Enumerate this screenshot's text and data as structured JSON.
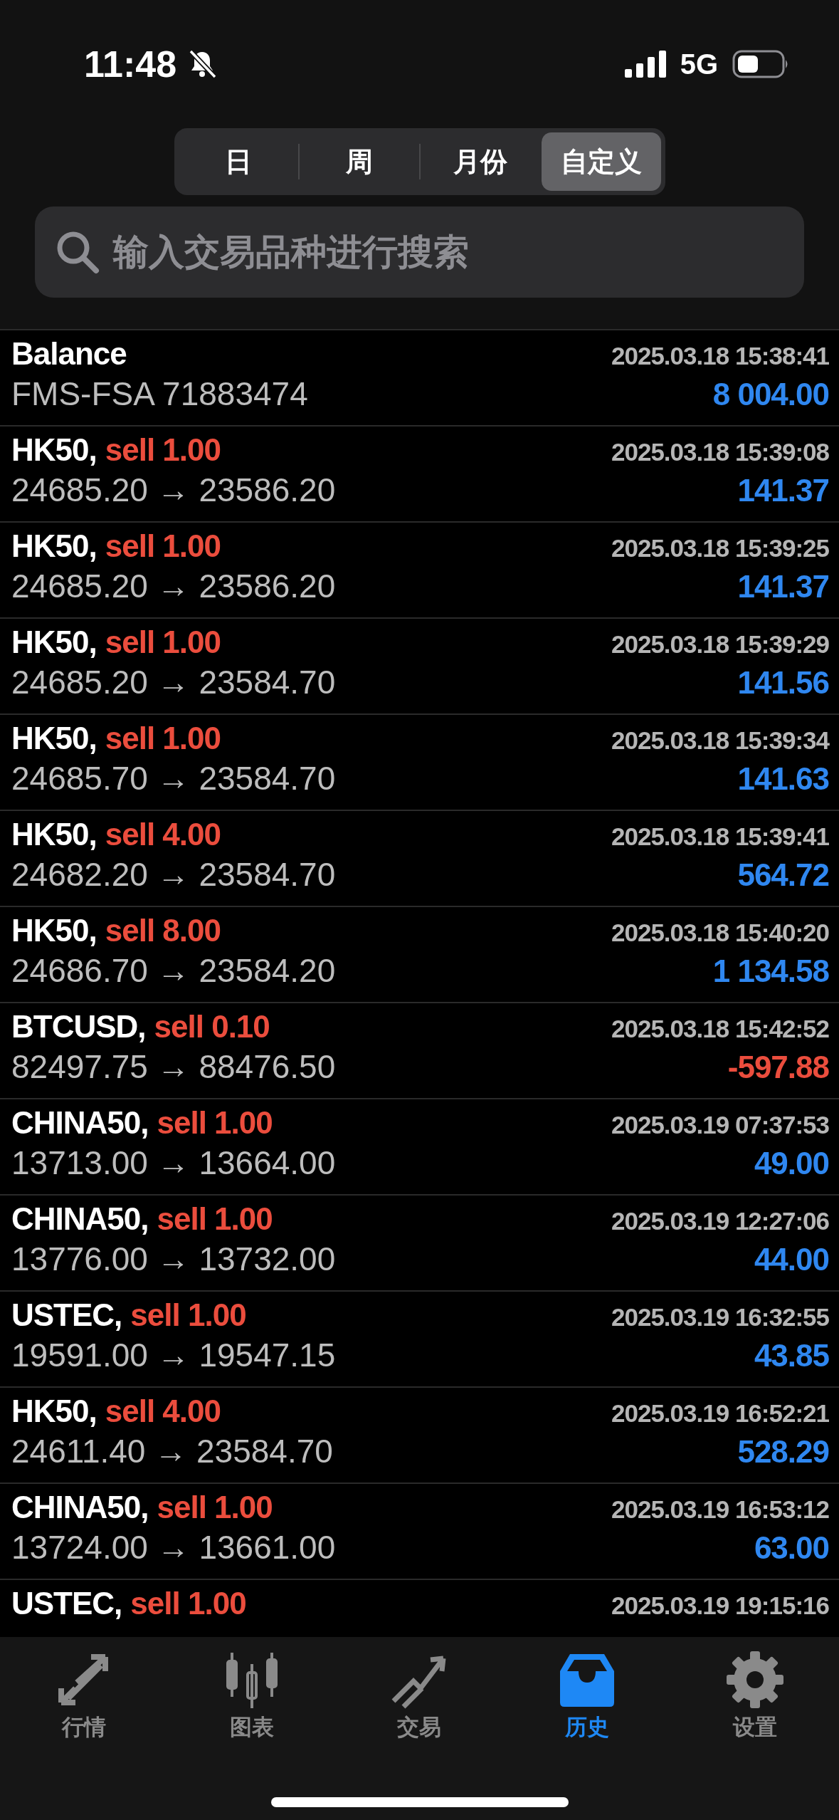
{
  "status_bar": {
    "time": "11:48",
    "network": "5G"
  },
  "period_tabs": [
    {
      "label": "日",
      "selected": false
    },
    {
      "label": "周",
      "selected": false
    },
    {
      "label": "月份",
      "selected": false
    },
    {
      "label": "自定义",
      "selected": true
    }
  ],
  "search": {
    "placeholder": "输入交易品种进行搜索"
  },
  "deals": [
    {
      "symbol": "Balance",
      "time": "2025.03.18 15:38:41",
      "detail": "FMS-FSA 71883474",
      "amount": "8 004.00",
      "negative": false
    },
    {
      "symbol": "HK50,",
      "side": "sell 1.00",
      "time": "2025.03.18 15:39:08",
      "detail": "24685.20 → 23586.20",
      "amount": "141.37",
      "negative": false
    },
    {
      "symbol": "HK50,",
      "side": "sell 1.00",
      "time": "2025.03.18 15:39:25",
      "detail": "24685.20 → 23586.20",
      "amount": "141.37",
      "negative": false
    },
    {
      "symbol": "HK50,",
      "side": "sell 1.00",
      "time": "2025.03.18 15:39:29",
      "detail": "24685.20 → 23584.70",
      "amount": "141.56",
      "negative": false
    },
    {
      "symbol": "HK50,",
      "side": "sell 1.00",
      "time": "2025.03.18 15:39:34",
      "detail": "24685.70 → 23584.70",
      "amount": "141.63",
      "negative": false
    },
    {
      "symbol": "HK50,",
      "side": "sell 4.00",
      "time": "2025.03.18 15:39:41",
      "detail": "24682.20 → 23584.70",
      "amount": "564.72",
      "negative": false
    },
    {
      "symbol": "HK50,",
      "side": "sell 8.00",
      "time": "2025.03.18 15:40:20",
      "detail": "24686.70 → 23584.20",
      "amount": "1 134.58",
      "negative": false
    },
    {
      "symbol": "BTCUSD,",
      "side": "sell 0.10",
      "time": "2025.03.18 15:42:52",
      "detail": "82497.75 → 88476.50",
      "amount": "-597.88",
      "negative": true
    },
    {
      "symbol": "CHINA50,",
      "side": "sell 1.00",
      "time": "2025.03.19 07:37:53",
      "detail": "13713.00 → 13664.00",
      "amount": "49.00",
      "negative": false
    },
    {
      "symbol": "CHINA50,",
      "side": "sell 1.00",
      "time": "2025.03.19 12:27:06",
      "detail": "13776.00 → 13732.00",
      "amount": "44.00",
      "negative": false
    },
    {
      "symbol": "USTEC,",
      "side": "sell 1.00",
      "time": "2025.03.19 16:32:55",
      "detail": "19591.00 → 19547.15",
      "amount": "43.85",
      "negative": false
    },
    {
      "symbol": "HK50,",
      "side": "sell 4.00",
      "time": "2025.03.19 16:52:21",
      "detail": "24611.40 → 23584.70",
      "amount": "528.29",
      "negative": false
    },
    {
      "symbol": "CHINA50,",
      "side": "sell 1.00",
      "time": "2025.03.19 16:53:12",
      "detail": "13724.00 → 13661.00",
      "amount": "63.00",
      "negative": false
    },
    {
      "symbol": "USTEC,",
      "side": "sell 1.00",
      "time": "2025.03.19 19:15:16"
    }
  ],
  "tab_bar": [
    {
      "kind": "quotes",
      "label": "行情",
      "selected": false
    },
    {
      "kind": "chart",
      "label": "图表",
      "selected": false
    },
    {
      "kind": "trade",
      "label": "交易",
      "selected": false
    },
    {
      "kind": "history",
      "label": "历史",
      "selected": true
    },
    {
      "kind": "settings",
      "label": "设置",
      "selected": false
    }
  ]
}
